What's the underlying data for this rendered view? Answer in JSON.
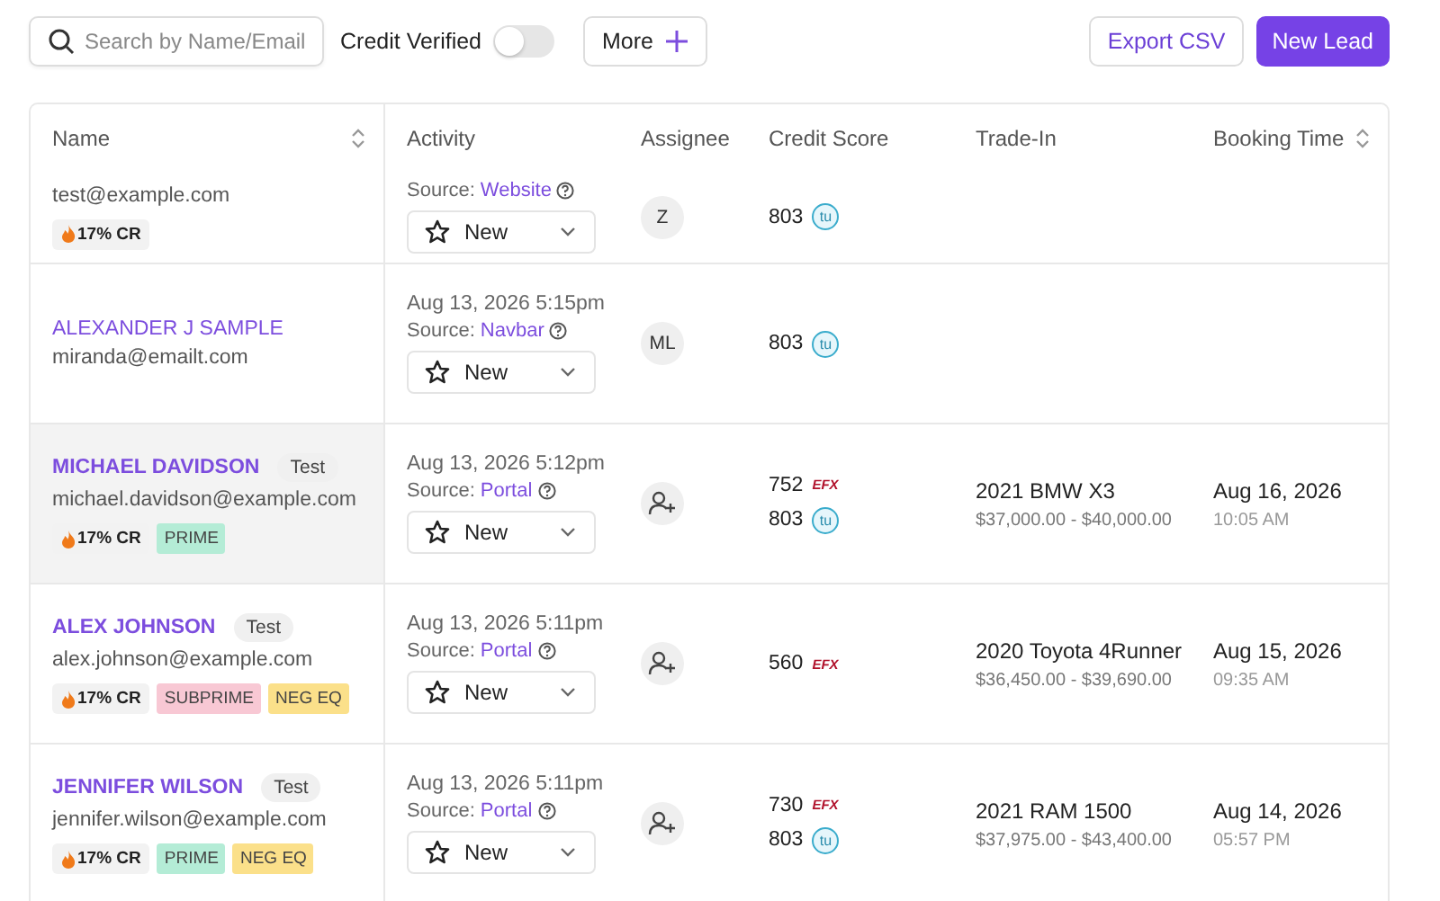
{
  "toolbar": {
    "search": {
      "placeholder": "Search by Name/Email"
    },
    "credit_verified": {
      "label": "Credit Verified",
      "on": false
    },
    "more_button": "More",
    "export_button": "Export CSV",
    "new_lead_button": "New Lead"
  },
  "table": {
    "columns": [
      {
        "label": "Name",
        "sortable": true
      },
      {
        "label": "Activity"
      },
      {
        "label": "Assignee"
      },
      {
        "label": "Credit Score"
      },
      {
        "label": "Trade-In"
      },
      {
        "label": "Booking Time",
        "sortable": true
      }
    ],
    "rows": [
      {
        "selected": false,
        "email": "test@example.com",
        "cr": "17% CR",
        "tags": [],
        "source_label": "Source:",
        "source": "Website",
        "status": "New",
        "assignee": {
          "kind": "initials",
          "text": "Z"
        },
        "scores": [
          {
            "value": "803",
            "kind": "circle",
            "mark": "tu"
          }
        ]
      },
      {
        "selected": false,
        "name": "ALEXANDER J SAMPLE",
        "email": "miranda@emailt.com",
        "tags": [],
        "date": "Aug 13, 2026 5:15pm",
        "source_label": "Source:",
        "source": "Navbar",
        "status": "New",
        "assignee": {
          "kind": "initials",
          "text": "ML"
        },
        "scores": [
          {
            "value": "803",
            "kind": "circle",
            "mark": "tu"
          }
        ]
      },
      {
        "selected": true,
        "name": "MICHAEL DAVIDSON",
        "test": "Test",
        "email": "michael.davidson@example.com",
        "cr": "17% CR",
        "tags": [
          {
            "label": "PRIME",
            "color": "#b4ecd6"
          }
        ],
        "date": "Aug 13, 2026 5:12pm",
        "source_label": "Source:",
        "source": "Portal",
        "status": "New",
        "assignee": {
          "kind": "unassigned"
        },
        "scores": [
          {
            "value": "752",
            "kind": "italic",
            "mark": "EFX"
          },
          {
            "value": "803",
            "kind": "circle",
            "mark": "tu"
          }
        ],
        "vehicle": "2021 BMW X3",
        "price": "$37,000.00 - $40,000.00",
        "booking_date": "Aug 16, 2026",
        "booking_time": "10:05 AM"
      },
      {
        "selected": false,
        "name": "ALEX JOHNSON",
        "test": "Test",
        "email": "alex.johnson@example.com",
        "cr": "17% CR",
        "tags": [
          {
            "label": "SUBPRIME",
            "color": "#f8c8d4"
          },
          {
            "label": "NEG EQ",
            "color": "#fbe08a"
          }
        ],
        "date": "Aug 13, 2026 5:11pm",
        "source_label": "Source:",
        "source": "Portal",
        "status": "New",
        "assignee": {
          "kind": "unassigned"
        },
        "scores": [
          {
            "value": "560",
            "kind": "italic",
            "mark": "EFX"
          }
        ],
        "vehicle": "2020 Toyota 4Runner",
        "price": "$36,450.00 - $39,690.00",
        "booking_date": "Aug 15, 2026",
        "booking_time": "09:35 AM"
      },
      {
        "selected": false,
        "name": "JENNIFER WILSON",
        "test": "Test",
        "email": "jennifer.wilson@example.com",
        "cr": "17% CR",
        "tags": [
          {
            "label": "PRIME",
            "color": "#b4ecd6"
          },
          {
            "label": "NEG EQ",
            "color": "#fbe08a"
          }
        ],
        "date": "Aug 13, 2026 5:11pm",
        "source_label": "Source:",
        "source": "Portal",
        "status": "New",
        "assignee": {
          "kind": "unassigned"
        },
        "scores": [
          {
            "value": "730",
            "kind": "italic",
            "mark": "EFX"
          },
          {
            "value": "803",
            "kind": "circle",
            "mark": "tu"
          }
        ],
        "vehicle": "2021 RAM 1500",
        "price": "$37,975.00 - $43,400.00",
        "booking_date": "Aug 14, 2026",
        "booking_time": "05:57 PM"
      }
    ]
  }
}
